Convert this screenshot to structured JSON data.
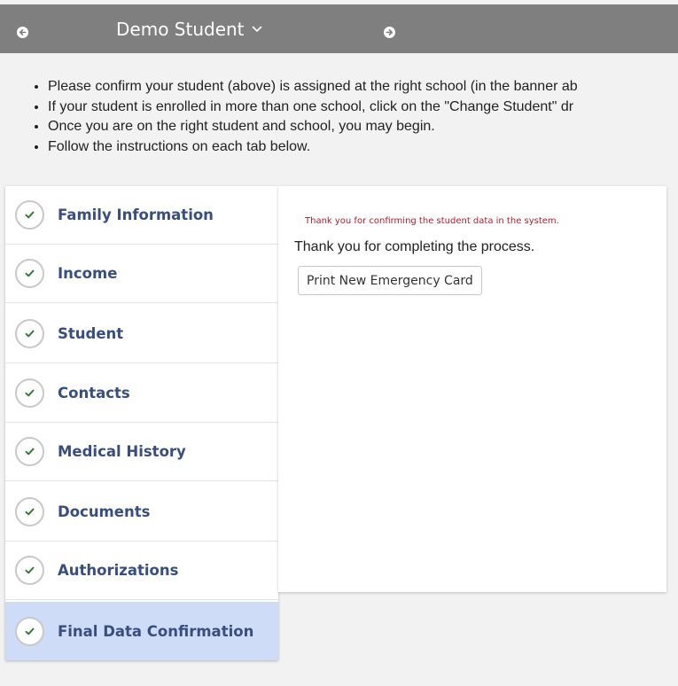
{
  "header": {
    "student_name": "Demo Student",
    "prev_icon": "chevron-left-circle-icon",
    "next_icon": "chevron-right-circle-icon",
    "dropdown_icon": "chevron-down-icon"
  },
  "instructions": [
    "Please confirm your student (above) is assigned at the right school (in the banner ab",
    "If your student is enrolled in more than one school, click on the \"Change Student\" dr",
    "Once you are on the right student and school, you may begin.",
    "Follow the instructions on each tab below."
  ],
  "tabs": [
    {
      "label": "Family Information",
      "status_icon": "check-icon",
      "active": false
    },
    {
      "label": "Income",
      "status_icon": "check-icon",
      "active": false
    },
    {
      "label": "Student",
      "status_icon": "check-icon",
      "active": false
    },
    {
      "label": "Contacts",
      "status_icon": "check-icon",
      "active": false
    },
    {
      "label": "Medical History",
      "status_icon": "check-icon",
      "active": false
    },
    {
      "label": "Documents",
      "status_icon": "check-icon",
      "active": false
    },
    {
      "label": "Authorizations",
      "status_icon": "check-icon",
      "active": false
    },
    {
      "label": "Final Data Confirmation",
      "status_icon": "check-icon",
      "active": true
    }
  ],
  "content": {
    "confirmation_message": "Thank you for confirming the student data in the system.",
    "thanks_message": "Thank you for completing the process.",
    "print_button_label": "Print New Emergency Card"
  },
  "colors": {
    "header_bg": "#7f7f7f",
    "tab_label": "#394e80",
    "active_tab_bg": "#cfdcf7",
    "check_green": "#2e7d32",
    "confirmation_red": "#b01c2e"
  }
}
